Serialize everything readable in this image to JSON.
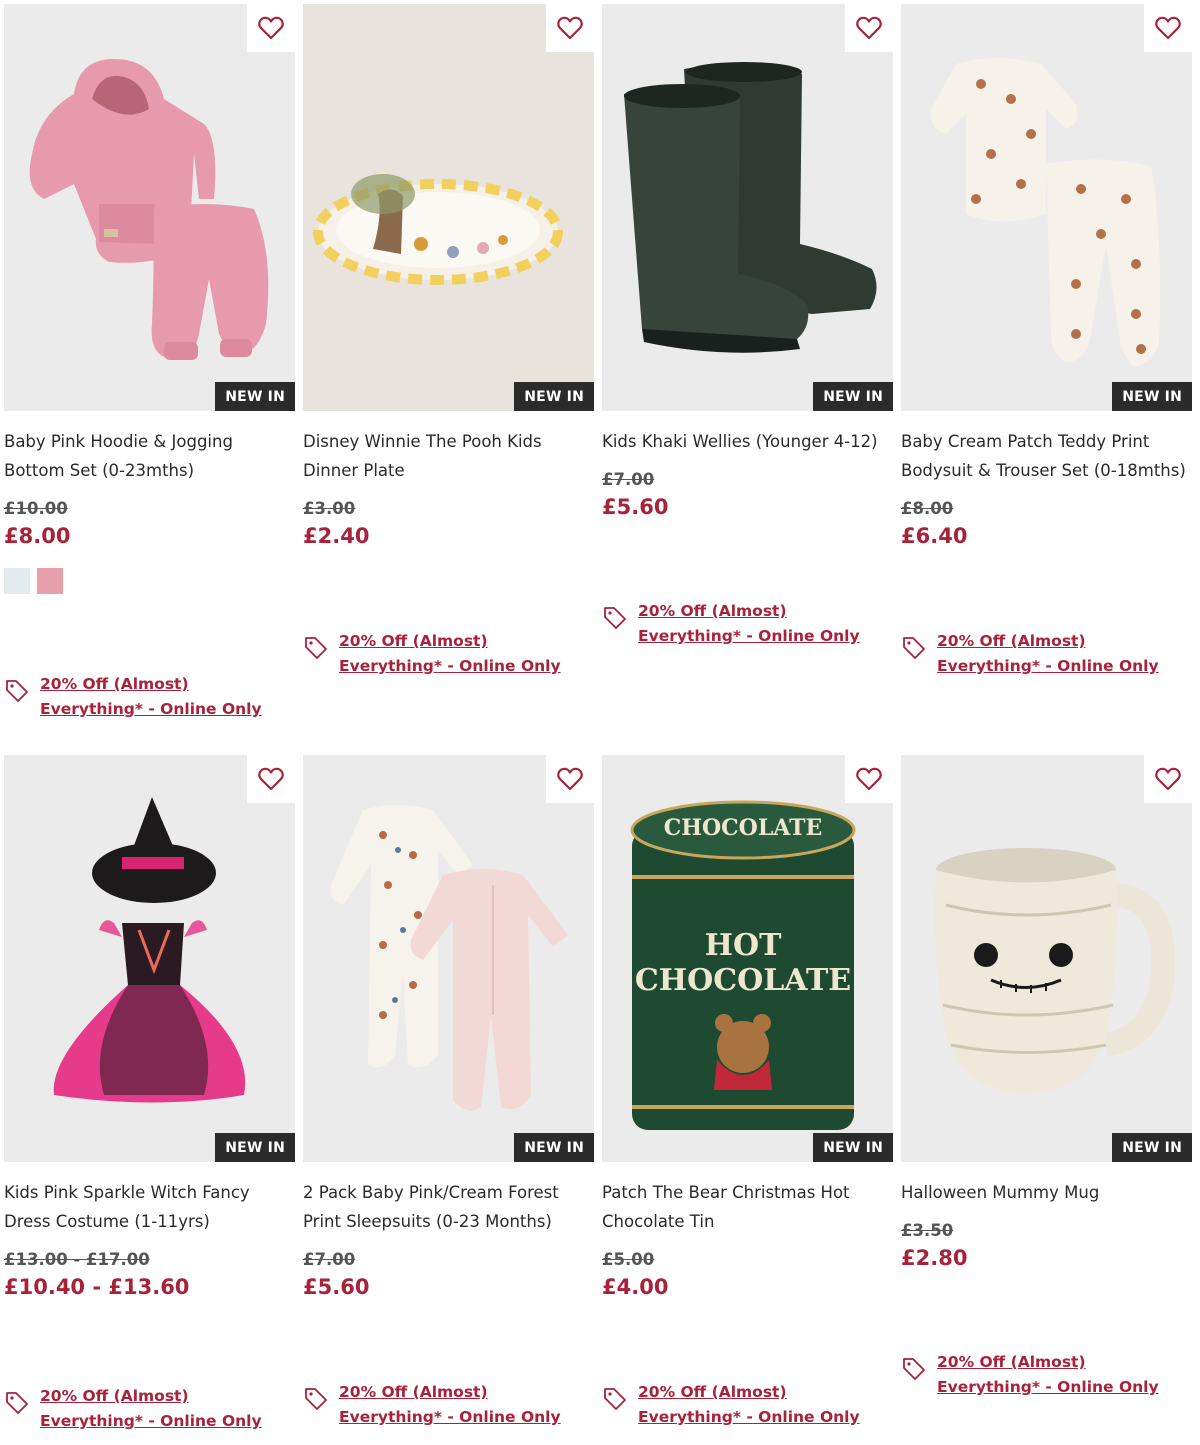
{
  "colors": {
    "accent": "#a8223a",
    "badge_bg": "#2b2b2b",
    "was_price": "#555555"
  },
  "icons": {
    "wishlist": "heart-outline-icon",
    "promo": "price-tag-icon"
  },
  "products": [
    {
      "title": "Baby Pink Hoodie & Jogging Bottom Set (0-23mths)",
      "badge": "NEW IN",
      "was_price": "£10.00",
      "price": "£8.00",
      "swatches": [
        "#e4ebef",
        "#e8a1ac"
      ],
      "promo": "20% Off (Almost) Everything* - Online Only"
    },
    {
      "title": "Disney Winnie The Pooh Kids Dinner Plate",
      "badge": "NEW IN",
      "was_price": "£3.00",
      "price": "£2.40",
      "promo": "20% Off (Almost) Everything* - Online Only"
    },
    {
      "title": "Kids Khaki Wellies (Younger 4-12)",
      "badge": "NEW IN",
      "was_price": "£7.00",
      "price": "£5.60",
      "promo": "20% Off (Almost) Everything* - Online Only"
    },
    {
      "title": "Baby Cream Patch Teddy Print Bodysuit & Trouser Set (0-18mths)",
      "badge": "NEW IN",
      "was_price": "£8.00",
      "price": "£6.40",
      "promo": "20% Off (Almost) Everything* - Online Only"
    },
    {
      "title": "Kids Pink Sparkle Witch Fancy Dress Costume (1-11yrs)",
      "badge": "NEW IN",
      "was_price": "£13.00 - £17.00",
      "price": "£10.40 - £13.60",
      "promo": "20% Off (Almost) Everything* - Online Only"
    },
    {
      "title": "2 Pack Baby Pink/Cream Forest Print Sleepsuits (0-23 Months)",
      "badge": "NEW IN",
      "was_price": "£7.00",
      "price": "£5.60",
      "promo": "20% Off (Almost) Everything* - Online Only"
    },
    {
      "title": "Patch The Bear Christmas Hot Chocolate Tin",
      "badge": "NEW IN",
      "was_price": "£5.00",
      "price": "£4.00",
      "tin_text": [
        "HOT",
        "CHOCOLATE"
      ],
      "promo": "20% Off (Almost) Everything* - Online Only"
    },
    {
      "title": "Halloween Mummy Mug",
      "badge": "NEW IN",
      "was_price": "£3.50",
      "price": "£2.80",
      "promo": "20% Off (Almost) Everything* - Online Only"
    }
  ]
}
